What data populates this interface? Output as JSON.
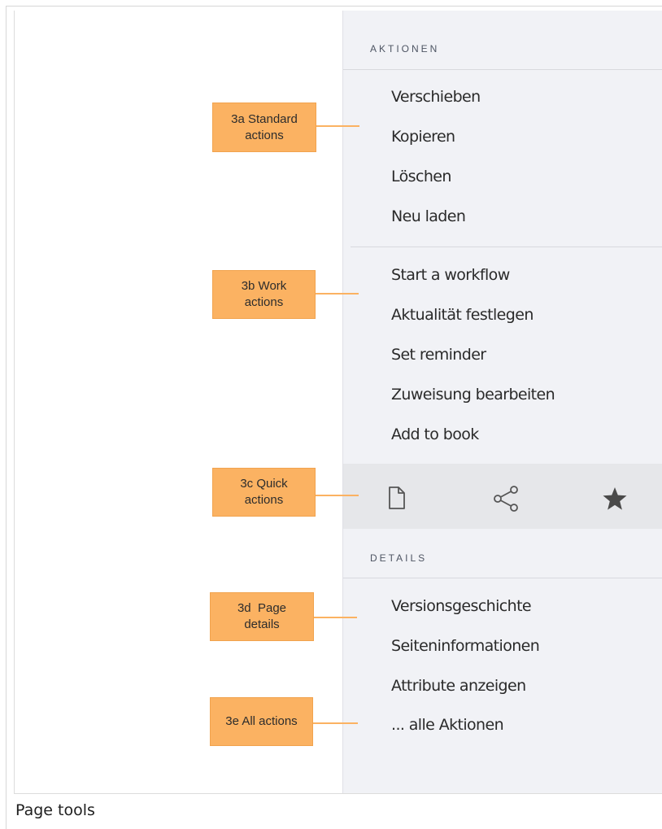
{
  "sidebar": {
    "actions_title": "AKTIONEN",
    "standard_actions": [
      "Verschieben",
      "Kopieren",
      "Löschen",
      "Neu laden"
    ],
    "work_actions": [
      "Start a workflow",
      "Aktualität festlegen",
      "Set reminder",
      "Zuweisung bearbeiten",
      "Add to book"
    ],
    "quick_actions": [
      "page-icon",
      "share-icon",
      "star-icon"
    ],
    "details_title": "DETAILS",
    "details": [
      "Versionsgeschichte",
      "Seiteninformationen",
      "Attribute anzeigen",
      "... alle Aktionen"
    ]
  },
  "callouts": {
    "standard_line1": "3a Standard",
    "standard_line2": "actions",
    "work_line1": "3b Work",
    "work_line2": "actions",
    "quick_line1": "3c Quick",
    "quick_line2": "actions",
    "details_line1": "3d  Page",
    "details_line2": "details",
    "all": "3e All actions"
  },
  "caption": "Page tools",
  "colors": {
    "callout": "#fbb262",
    "sidebar_bg": "#f1f2f6",
    "quickbar_bg": "#e6e7ea"
  }
}
